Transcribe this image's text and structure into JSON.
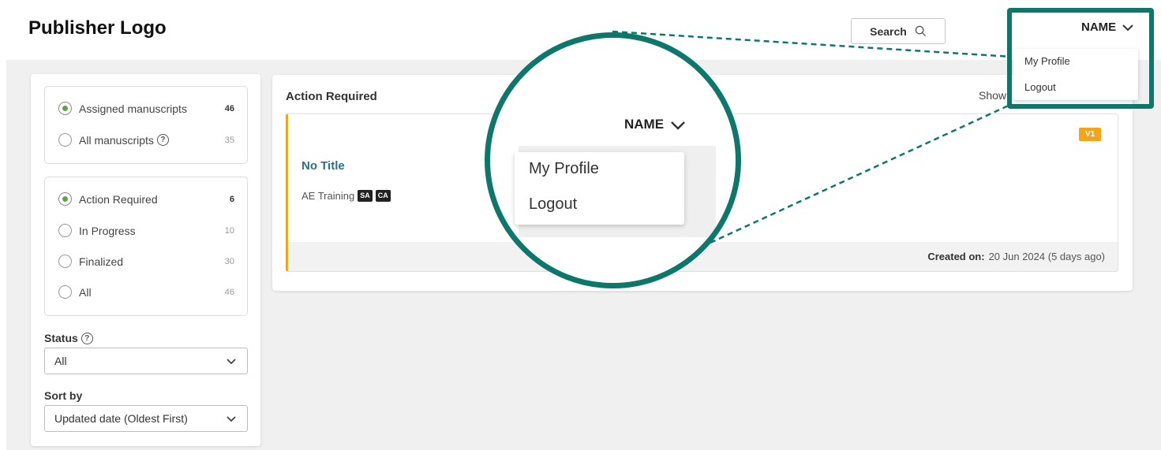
{
  "header": {
    "logo": "Publisher Logo",
    "search_label": "Search",
    "user_name": "NAME"
  },
  "user_menu": {
    "items": [
      {
        "label": "My Profile"
      },
      {
        "label": "Logout"
      }
    ]
  },
  "sidebar": {
    "scope_filters": [
      {
        "label": "Assigned manuscripts",
        "count": "46",
        "selected": true
      },
      {
        "label": "All manuscripts",
        "count": "35",
        "selected": false
      }
    ],
    "status_filters": [
      {
        "label": "Action Required",
        "count": "6",
        "selected": true
      },
      {
        "label": "In Progress",
        "count": "10",
        "selected": false
      },
      {
        "label": "Finalized",
        "count": "30",
        "selected": false
      },
      {
        "label": "All",
        "count": "46",
        "selected": false
      }
    ],
    "status": {
      "label": "Status",
      "value": "All"
    },
    "sort": {
      "label": "Sort by",
      "value": "Updated date (Oldest First)"
    }
  },
  "main": {
    "title": "Action Required",
    "show_label": "Show",
    "card": {
      "title": "No Title",
      "subtitle": "AE Training",
      "tags": [
        "SA",
        "CA"
      ],
      "version": "V1",
      "created_label": "Created on:",
      "created_value": "20 Jun 2024 (5 days ago)"
    }
  },
  "magnifier": {
    "user_name": "NAME",
    "items": [
      {
        "label": "My Profile"
      },
      {
        "label": "Logout"
      }
    ]
  },
  "colors": {
    "highlight": "#0e776b",
    "accent_orange": "#f4a418",
    "radio_selected": "#5ba843",
    "title_link": "#2c6f86"
  }
}
